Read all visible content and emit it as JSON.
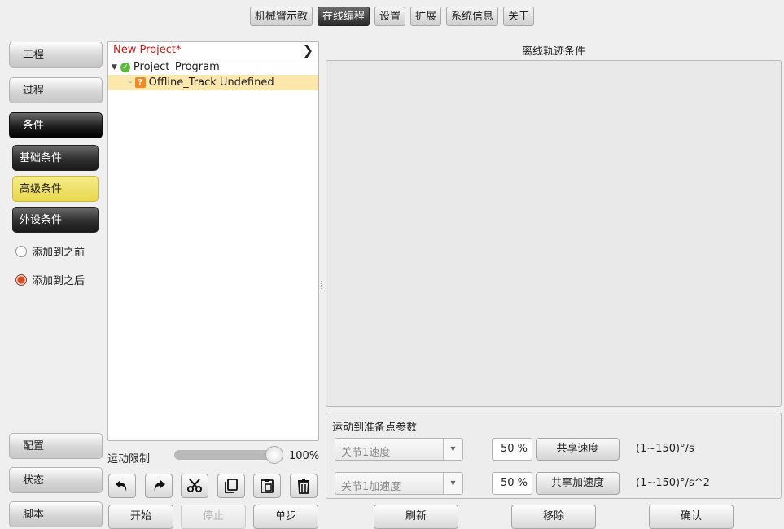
{
  "top_tabs": [
    "机械臂示教",
    "在线编程",
    "设置",
    "扩展",
    "系统信息",
    "关于"
  ],
  "top_tabs_active": "在线编程",
  "left_nav": {
    "project": "工程",
    "process": "过程",
    "condition": "条件",
    "basic_condition": "基础条件",
    "advanced_condition": "高级条件",
    "peripheral_condition": "外设条件",
    "add_before": "添加到之前",
    "add_after": "添加到之后",
    "config": "配置",
    "status": "状态",
    "script": "脚本"
  },
  "tree": {
    "title": "New Project*",
    "root": "Project_Program",
    "child": "Offline_Track Undefined"
  },
  "condition_panel": {
    "title": "离线轨迹条件"
  },
  "params": {
    "title": "运动到准备点参数",
    "rows": [
      {
        "select": "关节1速度",
        "percent": "50 %",
        "button": "共享速度",
        "range": "(1~150)°/s"
      },
      {
        "select": "关节1加速度",
        "percent": "50 %",
        "button": "共享加速度",
        "range": "(1~150)°/s^2"
      }
    ]
  },
  "motion_limit": {
    "label": "运动限制",
    "value_text": "100%",
    "fraction": 1.0
  },
  "run_buttons": {
    "start": "开始",
    "stop": "停止",
    "step": "单步"
  },
  "action_buttons": {
    "refresh": "刷新",
    "remove": "移除",
    "confirm": "确认"
  },
  "icons": [
    "undo-icon",
    "redo-icon",
    "cut-icon",
    "copy-icon",
    "paste-icon",
    "delete-icon"
  ],
  "colors": {
    "accent_yellow": "#e8d74e",
    "title_red": "#d21414",
    "selected_row": "#fce7ad"
  }
}
